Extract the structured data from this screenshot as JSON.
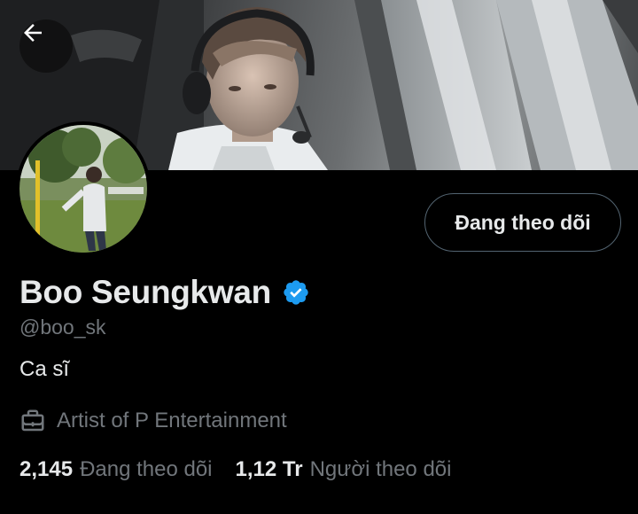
{
  "profile": {
    "name": "Boo Seungkwan",
    "handle": "@boo_sk",
    "bio": "Ca sĩ",
    "work": "Artist of P Entertainment",
    "verified": true
  },
  "actions": {
    "follow_label": "Đang theo dõi"
  },
  "stats": {
    "following_count": "2,145",
    "following_label": "Đang theo dõi",
    "followers_count": "1,12 Tr",
    "followers_label": "Người theo dõi"
  },
  "icons": {
    "back": "arrow-left-icon",
    "verified": "verified-badge-icon",
    "work": "briefcase-icon"
  },
  "colors": {
    "background": "#000000",
    "text_primary": "#e7e9ea",
    "text_secondary": "#71767b",
    "verified_blue": "#1d9bf0",
    "button_border": "#536471"
  }
}
